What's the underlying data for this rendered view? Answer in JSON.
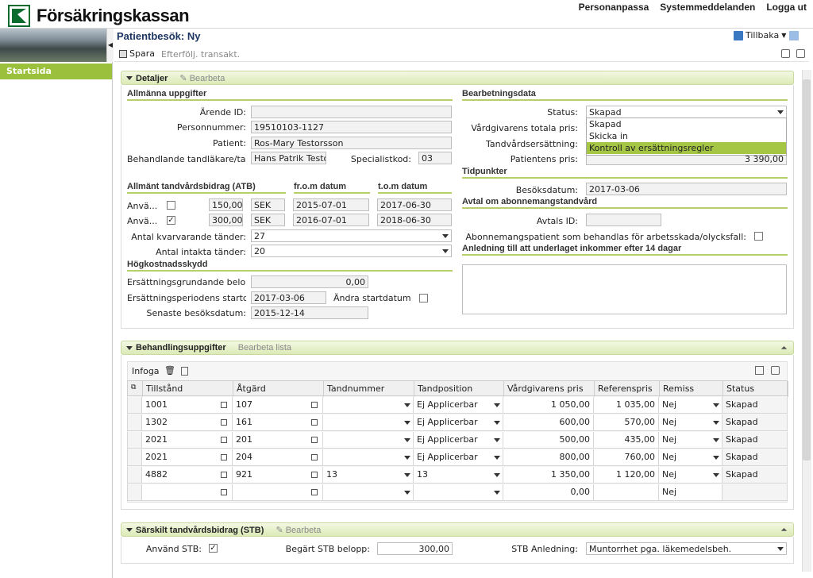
{
  "app": {
    "brand": "Försäkringskassan",
    "toplinks": [
      "Personanpassa",
      "Systemmeddelanden",
      "Logga ut"
    ],
    "sidebar_item": "Startsida",
    "page_title": "Patientbesök: Ny",
    "back_label": "Tillbaka",
    "save_label": "Spara",
    "followup_label": "Efterfölj. transakt."
  },
  "details": {
    "title": "Detaljer",
    "edit": "Bearbeta",
    "general": {
      "heading": "Allmänna uppgifter",
      "arende_label": "Ärende ID:",
      "arende_value": "",
      "personnummer_label": "Personnummer:",
      "personnummer_value": "19510103-1127",
      "patient_label": "Patient:",
      "patient_value": "Ros-Mary Testorsson",
      "tandlakare_label": "Behandlande tandläkare/tan...",
      "tandlakare_value": "Hans Patrik Testor",
      "specialist_label": "Specialistkod:",
      "specialist_value": "03"
    },
    "atb": {
      "heading": "Allmänt tandvårdsbidrag (ATB)",
      "from_heading": "fr.o.m datum",
      "tom_heading": "t.o.m datum",
      "rows": [
        {
          "label": "Anvä...",
          "checked": "",
          "amount": "150,00",
          "currency": "SEK",
          "from": "2015-07-01",
          "to": "2017-06-30"
        },
        {
          "label": "Anvä...",
          "checked": "✓",
          "amount": "300,00",
          "currency": "SEK",
          "from": "2016-07-01",
          "to": "2018-06-30"
        }
      ],
      "remaining_label": "Antal kvarvarande tänder:",
      "remaining_value": "27",
      "intact_label": "Antal intakta tänder:",
      "intact_value": "20"
    },
    "hkskydd": {
      "heading": "Högkostnadsskydd",
      "grund_label": "Ersättningsgrundande belopp:",
      "grund_value": "0,00",
      "start_label": "Ersättningsperiodens startd...",
      "start_value": "2017-03-06",
      "andra_label": "Ändra startdatum:",
      "senaste_label": "Senaste besöksdatum:",
      "senaste_value": "2015-12-14"
    },
    "processing": {
      "heading": "Bearbetningsdata",
      "status_label": "Status:",
      "status_value": "Skapad",
      "status_options": [
        "Skapad",
        "Skicka in",
        "Kontroll av ersättningsregler"
      ],
      "total_label": "Vårdgivarens totala pris:",
      "ersattning_label": "Tandvårdsersättning:",
      "patientpris_label": "Patientens pris:",
      "patientpris_value": "3 390,00"
    },
    "tidpunkter": {
      "heading": "Tidpunkter",
      "besok_label": "Besöksdatum:",
      "besok_value": "2017-03-06"
    },
    "avtal": {
      "heading": "Avtal om abonnemangstandvård",
      "avtal_label": "Avtals ID:",
      "avtal_value": "",
      "abon_label": "Abonnemangspatient som behandlas för arbetsskada/olycksfall:"
    },
    "anledning": {
      "heading": "Anledning till att underlaget inkommer efter 14 dagar",
      "value": ""
    }
  },
  "treatment": {
    "title": "Behandlingsuppgifter",
    "edit": "Bearbeta lista",
    "insert": "Infoga",
    "columns": [
      "Tillstånd",
      "Åtgärd",
      "Tandnummer",
      "Tandposition",
      "Vårdgivarens pris",
      "Referenspris",
      "Remiss",
      "Status"
    ],
    "rows": [
      [
        "1001",
        "107",
        "",
        "Ej Applicerbar",
        "1 050,00",
        "1 035,00",
        "Nej",
        "Skapad"
      ],
      [
        "1302",
        "161",
        "",
        "Ej Applicerbar",
        "600,00",
        "570,00",
        "Nej",
        "Skapad"
      ],
      [
        "2021",
        "201",
        "",
        "Ej Applicerbar",
        "500,00",
        "435,00",
        "Nej",
        "Skapad"
      ],
      [
        "2021",
        "204",
        "",
        "Ej Applicerbar",
        "800,00",
        "760,00",
        "Nej",
        "Skapad"
      ],
      [
        "4882",
        "921",
        "13",
        "13",
        "1 350,00",
        "1 120,00",
        "Nej",
        "Skapad"
      ],
      [
        "",
        "",
        "",
        "",
        "0,00",
        "",
        "Nej",
        ""
      ]
    ]
  },
  "stb": {
    "title": "Särskilt tandvårdsbidrag (STB)",
    "edit": "Bearbeta",
    "use_label": "Använd STB:",
    "use_checked": "✓",
    "amount_label": "Begärt STB belopp:",
    "amount_value": "300,00",
    "reason_label": "STB Anledning:",
    "reason_value": "Muntorrhet pga. läkemedelsbeh."
  },
  "colors": {
    "accent": "#9ac03c",
    "selected": "#a5c545",
    "title": "#1c3560"
  }
}
